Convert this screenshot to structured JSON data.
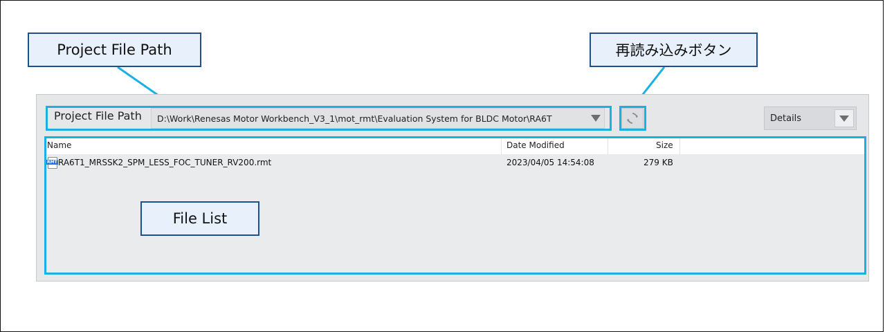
{
  "callouts": {
    "project_path": "Project File Path",
    "reload_button": "再読み込みボタン",
    "file_list": "File List"
  },
  "toolbar": {
    "path_label": "Project File Path",
    "path_value": "D:\\Work\\Renesas Motor Workbench_V3_1\\mot_rmt\\Evaluation System for BLDC Motor\\RA6T",
    "refresh_icon": "refresh-icon",
    "view_mode": "Details"
  },
  "file_list": {
    "columns": [
      "Name",
      "Date Modified",
      "Size"
    ],
    "rows": [
      {
        "icon_badge": "RMT",
        "name": "RA6T1_MRSSK2_SPM_LESS_FOC_TUNER_RV200.rmt",
        "date_modified": "2023/04/05 14:54:08",
        "size": "279 KB"
      }
    ]
  },
  "colors": {
    "highlight": "#19b0e6",
    "callout_border": "#1f4e8c",
    "callout_fill": "#e7f0fb"
  }
}
